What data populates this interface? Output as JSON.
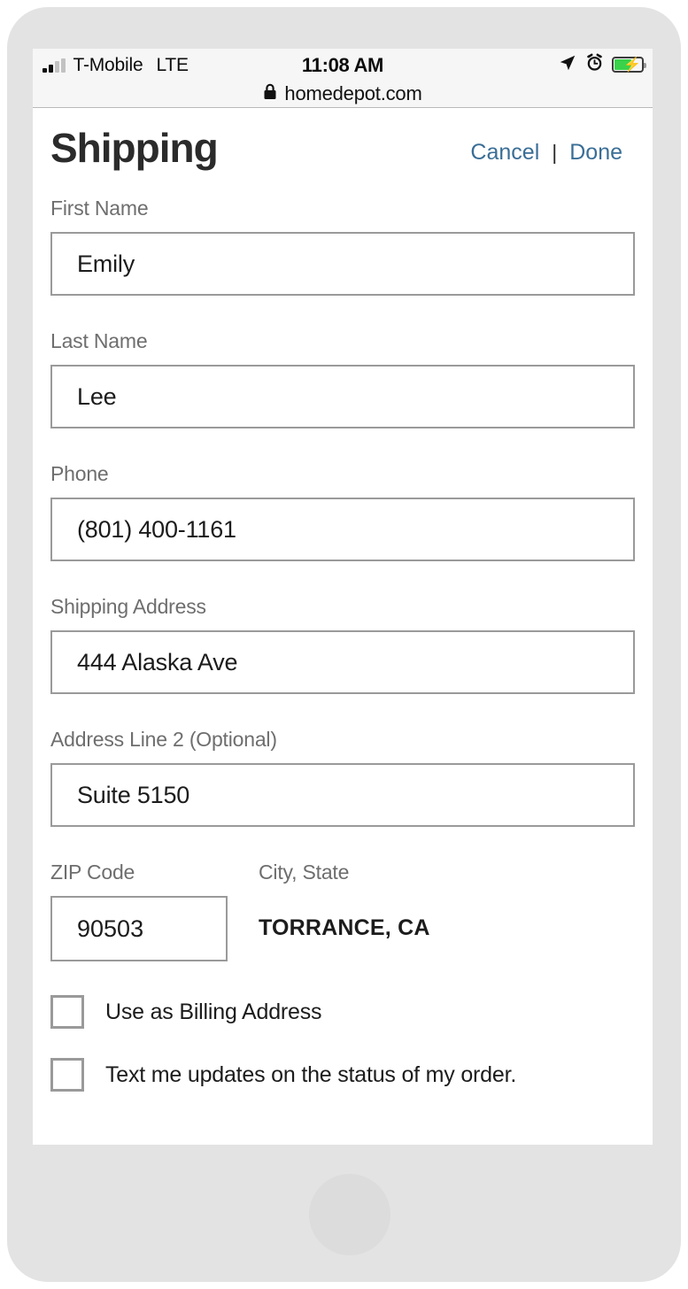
{
  "status_bar": {
    "carrier": "T-Mobile",
    "network": "LTE",
    "time": "11:08 AM",
    "signal_bars_filled": 2,
    "signal_bars_total": 4,
    "battery_charging": true,
    "battery_percent_approx": 55,
    "icons": [
      "location-arrow-icon",
      "alarm-clock-icon",
      "battery-charging-icon"
    ]
  },
  "browser": {
    "url": "homedepot.com",
    "secure": true,
    "lock_icon": "lock-icon"
  },
  "header": {
    "title": "Shipping",
    "cancel_label": "Cancel",
    "separator": "|",
    "done_label": "Done",
    "link_color": "#3a6e96"
  },
  "form": {
    "fields": [
      {
        "label": "First Name",
        "value": "Emily",
        "placeholder": "First Name"
      },
      {
        "label": "Last Name",
        "value": "Lee",
        "placeholder": "Last Name"
      },
      {
        "label": "Phone",
        "value": "(801) 400-1161",
        "placeholder": "Phone"
      },
      {
        "label": "Shipping Address",
        "value": "444 Alaska Ave",
        "placeholder": "Shipping Address"
      },
      {
        "label": "Address Line 2 (Optional)",
        "value": "Suite 5150",
        "placeholder": "Address Line 2 (Optional)"
      }
    ],
    "zip": {
      "label": "ZIP Code",
      "value": "90503",
      "placeholder": "ZIP Code"
    },
    "city_state": {
      "label": "City, State",
      "value": "TORRANCE, CA"
    },
    "checkboxes": [
      {
        "label": "Use as Billing Address",
        "checked": false
      },
      {
        "label": "Text me updates on the status of my order.",
        "checked": false
      }
    ]
  }
}
